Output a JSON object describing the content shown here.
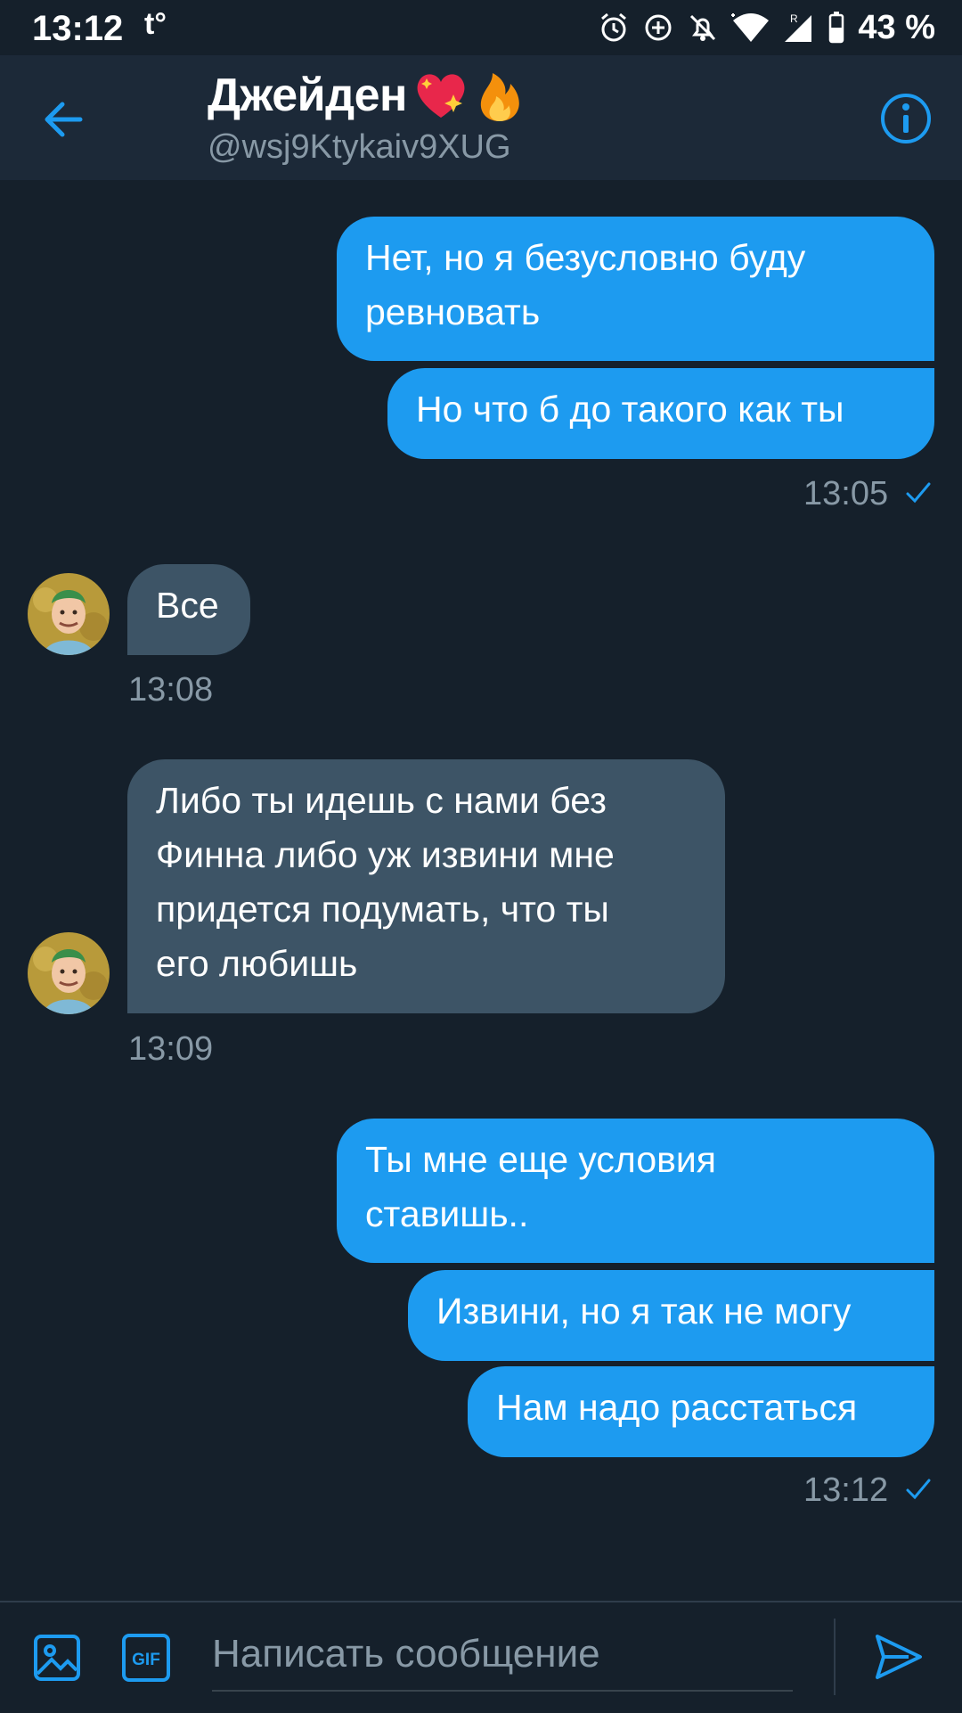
{
  "status_bar": {
    "time": "13:12",
    "left_icon": "t°",
    "battery": "43 %"
  },
  "header": {
    "name": "Джейден",
    "handle": "@wsj9Ktykaiv9XUG",
    "back_icon": "arrow-left-icon",
    "info_icon": "info-icon"
  },
  "messages": [
    {
      "dir": "out",
      "text_lines": [
        "Нет, но я безусловно буду",
        "ревновать"
      ]
    },
    {
      "dir": "out",
      "text_lines": [
        "Но что б до такого как ты"
      ]
    },
    {
      "dir": "out",
      "timestamp": "13:05"
    },
    {
      "dir": "in",
      "text_lines": [
        "Все"
      ]
    },
    {
      "dir": "in",
      "timestamp": "13:08"
    },
    {
      "dir": "in",
      "text_lines": [
        "Либо ты идешь с нами без",
        "Финна либо уж извини мне",
        "придется подумать, что ты",
        "его любишь"
      ]
    },
    {
      "dir": "in",
      "timestamp": "13:09"
    },
    {
      "dir": "out",
      "text_lines": [
        "Ты мне еще условия",
        "ставишь.."
      ]
    },
    {
      "dir": "out",
      "text_lines": [
        "Извини, но я так не могу"
      ]
    },
    {
      "dir": "out",
      "text_lines": [
        "Нам надо расстаться"
      ]
    },
    {
      "dir": "out",
      "timestamp": "13:12"
    }
  ],
  "composer": {
    "placeholder": "Написать сообщение",
    "gif_label": "GIF"
  },
  "colors": {
    "background": "#15202b",
    "header": "#1c2938",
    "outgoing": "#1d9bf0",
    "incoming": "#3d5466",
    "muted": "#8899a6"
  }
}
